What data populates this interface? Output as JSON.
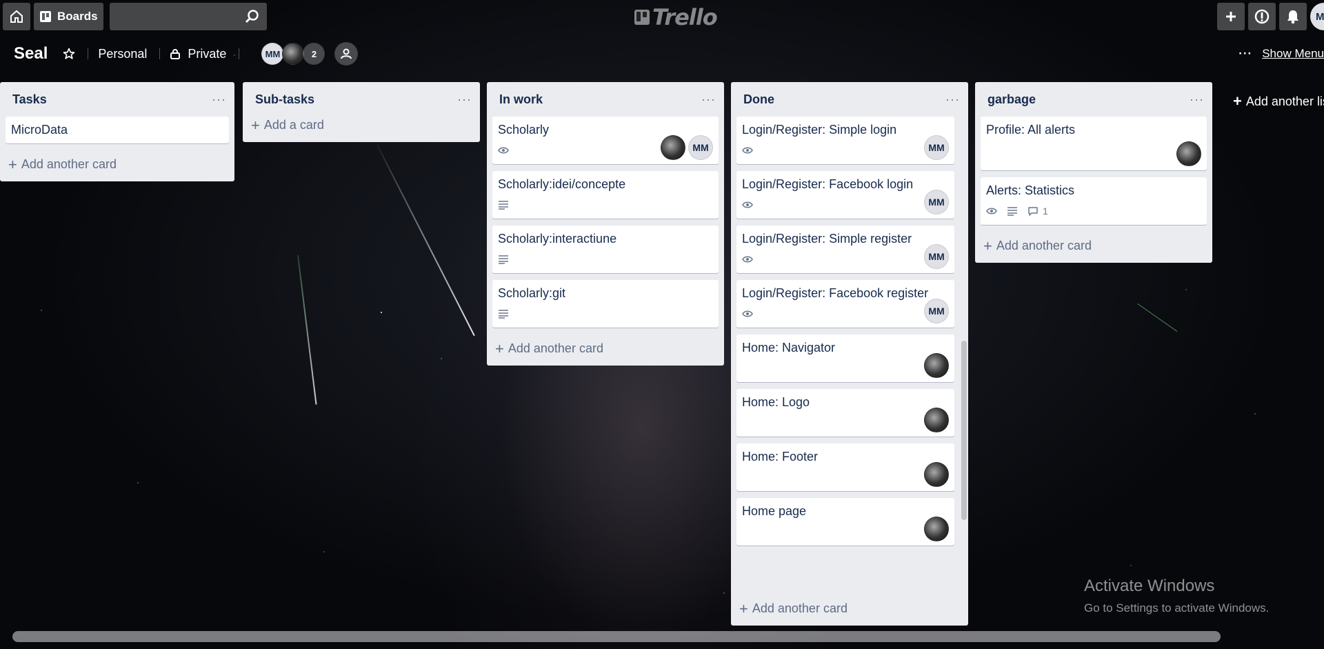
{
  "topbar": {
    "boards_label": "Boards",
    "search_value": "",
    "logo_text": "Trello",
    "user_initials": "MM"
  },
  "board": {
    "title": "Seal",
    "team": "Personal",
    "visibility": "Private",
    "members": [
      {
        "initials": "MM"
      },
      {
        "initials": ""
      }
    ],
    "member_count": "2",
    "show_menu": "Show Menu"
  },
  "lists": [
    {
      "title": "Tasks",
      "add_label": "Add another card",
      "cards": [
        {
          "title": "MicroData"
        }
      ]
    },
    {
      "title": "Sub-tasks",
      "add_label": "Add a card",
      "cards": []
    },
    {
      "title": "In work",
      "add_label": "Add another card",
      "cards": [
        {
          "title": "Scholarly",
          "badges": [
            "eye-icon"
          ],
          "members": [
            "photo",
            "MM"
          ]
        },
        {
          "title": "Scholarly:idei/concepte",
          "badges": [
            "description-icon"
          ]
        },
        {
          "title": "Scholarly:interactiune",
          "badges": [
            "description-icon"
          ]
        },
        {
          "title": "Scholarly:git",
          "badges": [
            "description-icon"
          ]
        }
      ]
    },
    {
      "title": "Done",
      "add_label": "Add another card",
      "cards": [
        {
          "title": "Login/Register: Simple login",
          "members": [
            "MM"
          ]
        },
        {
          "title": "Login/Register: Facebook login",
          "members": [
            "MM"
          ]
        },
        {
          "title": "Login/Register: Simple register",
          "members": [
            "MM"
          ]
        },
        {
          "title": "Login/Register: Facebook register",
          "members": [
            "MM"
          ]
        },
        {
          "title": "Home: Navigator",
          "members": [
            "photo"
          ]
        },
        {
          "title": "Home: Logo",
          "members": [
            "photo"
          ]
        },
        {
          "title": "Home: Footer",
          "members": [
            "photo"
          ]
        },
        {
          "title": "Home page",
          "members": [
            "photo"
          ]
        }
      ]
    },
    {
      "title": "garbage",
      "add_label": "Add another card",
      "cards": [
        {
          "title": "Profile: All alerts",
          "members": [
            "photo"
          ]
        },
        {
          "title": "Alerts: Statistics",
          "comments": "1"
        }
      ]
    }
  ],
  "add_list_label": "Add another list",
  "watermark": {
    "line1": "Activate Windows",
    "line2": "Go to Settings to activate Windows."
  }
}
